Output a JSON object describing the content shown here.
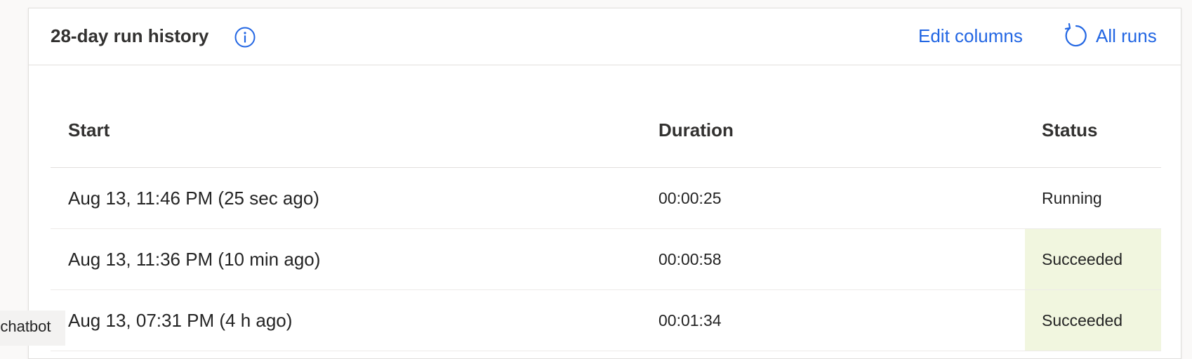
{
  "card": {
    "title": "28-day run history",
    "actions": {
      "edit_columns": "Edit columns",
      "all_runs": "All runs"
    }
  },
  "colors": {
    "link": "#2266e3",
    "succeeded_bg": "#f1f6df"
  },
  "table": {
    "headers": {
      "start": "Start",
      "duration": "Duration",
      "status": "Status"
    },
    "rows": [
      {
        "start": "Aug 13, 11:46 PM (25 sec ago)",
        "duration": "00:00:25",
        "status": "Running"
      },
      {
        "start": "Aug 13, 11:36 PM (10 min ago)",
        "duration": "00:00:58",
        "status": "Succeeded"
      },
      {
        "start": "Aug 13, 07:31 PM (4 h ago)",
        "duration": "00:01:34",
        "status": "Succeeded"
      }
    ]
  },
  "side_tab": {
    "label": "a chatbot"
  }
}
